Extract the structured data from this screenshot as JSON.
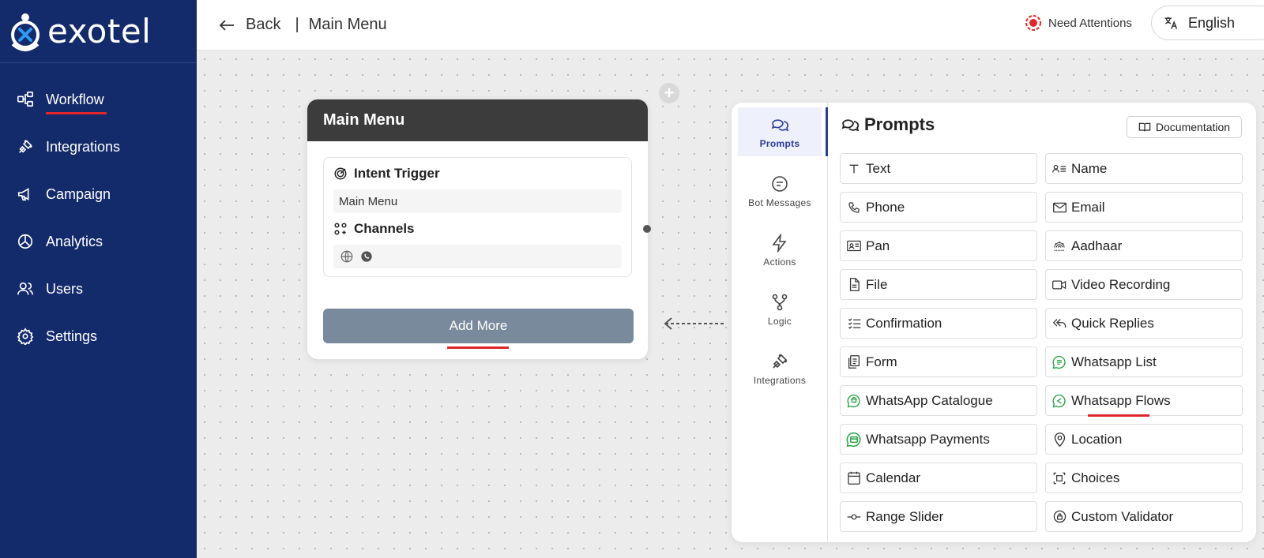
{
  "brand": {
    "name": "exotel"
  },
  "sidebar": {
    "items": [
      {
        "label": "Workflow",
        "icon": "workflow-icon",
        "active": true
      },
      {
        "label": "Integrations",
        "icon": "plug-icon"
      },
      {
        "label": "Campaign",
        "icon": "megaphone-icon"
      },
      {
        "label": "Analytics",
        "icon": "pie-chart-icon"
      },
      {
        "label": "Users",
        "icon": "users-icon"
      },
      {
        "label": "Settings",
        "icon": "gear-icon"
      }
    ]
  },
  "topbar": {
    "back_label": "Back",
    "separator": "|",
    "breadcrumb": "Main Menu",
    "attention_label": "Need Attentions",
    "language": "English"
  },
  "node": {
    "title": "Main Menu",
    "intent_title": "Intent Trigger",
    "intent_value": "Main Menu",
    "channels_title": "Channels",
    "channels": [
      "globe-icon",
      "whatsapp-icon"
    ],
    "add_more_label": "Add More"
  },
  "panel": {
    "rail": [
      {
        "label": "Prompts",
        "icon": "chat-bubbles-icon",
        "active": true
      },
      {
        "label": "Bot Messages",
        "icon": "message-icon"
      },
      {
        "label": "Actions",
        "icon": "lightning-icon"
      },
      {
        "label": "Logic",
        "icon": "branch-icon"
      },
      {
        "label": "Integrations",
        "icon": "plug-icon"
      }
    ],
    "title": "Prompts",
    "documentation_label": "Documentation",
    "options": [
      {
        "label": "Text",
        "icon": "text-icon"
      },
      {
        "label": "Name",
        "icon": "name-card-icon"
      },
      {
        "label": "Phone",
        "icon": "phone-icon"
      },
      {
        "label": "Email",
        "icon": "mail-icon"
      },
      {
        "label": "Pan",
        "icon": "id-card-icon"
      },
      {
        "label": "Aadhaar",
        "icon": "aadhaar-icon"
      },
      {
        "label": "File",
        "icon": "file-icon"
      },
      {
        "label": "Video Recording",
        "icon": "video-icon"
      },
      {
        "label": "Confirmation",
        "icon": "checklist-icon"
      },
      {
        "label": "Quick Replies",
        "icon": "reply-all-icon"
      },
      {
        "label": "Form",
        "icon": "form-icon"
      },
      {
        "label": "Whatsapp List",
        "icon": "whatsapp-list-icon"
      },
      {
        "label": "WhatsApp Catalogue",
        "icon": "whatsapp-catalogue-icon"
      },
      {
        "label": "Whatsapp Flows",
        "icon": "whatsapp-flows-icon"
      },
      {
        "label": "Whatsapp Payments",
        "icon": "whatsapp-payments-icon"
      },
      {
        "label": "Location",
        "icon": "location-pin-icon"
      },
      {
        "label": "Calendar",
        "icon": "calendar-icon"
      },
      {
        "label": "Choices",
        "icon": "choices-icon"
      },
      {
        "label": "Range Slider",
        "icon": "slider-icon"
      },
      {
        "label": "Custom Validator",
        "icon": "validator-icon"
      }
    ]
  },
  "colors": {
    "sidebar_bg": "#142b6b",
    "accent_red": "#e0262a",
    "node_header": "#3c3c3c",
    "add_more_bg": "#798a9c",
    "active_blue": "#2b3c9b",
    "whatsapp_green": "#25a244"
  }
}
